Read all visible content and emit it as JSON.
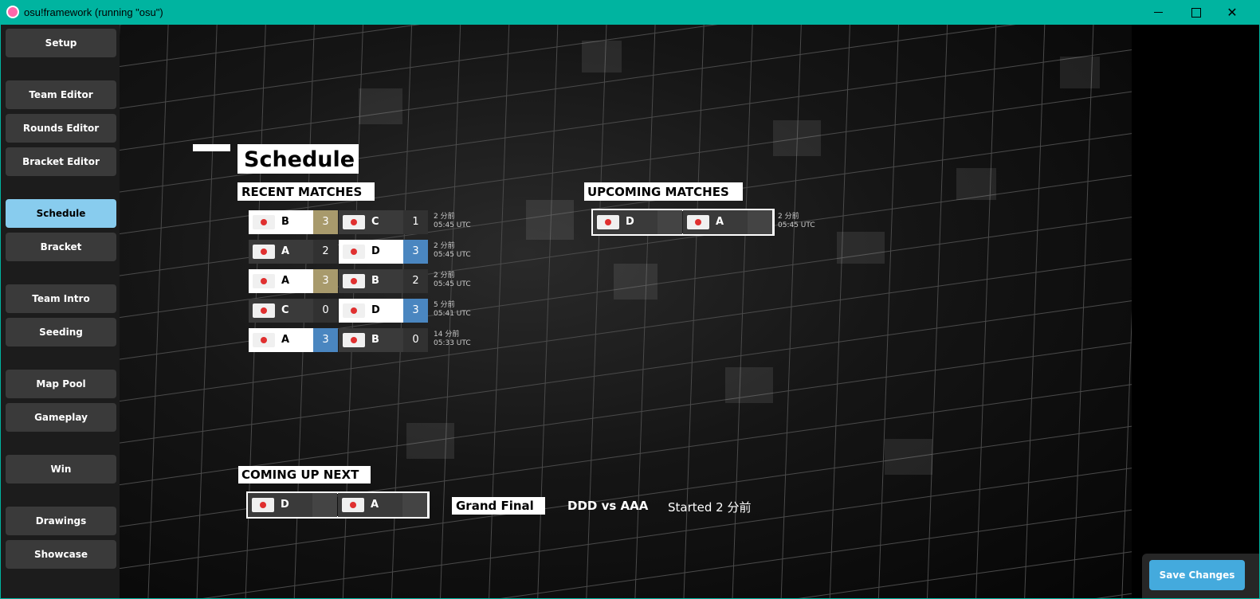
{
  "window": {
    "title": "osu!framework (running \"osu\")"
  },
  "sidebar": {
    "items": [
      {
        "label": "Setup",
        "active": false
      },
      {
        "label": "Team Editor",
        "active": false
      },
      {
        "label": "Rounds Editor",
        "active": false
      },
      {
        "label": "Bracket Editor",
        "active": false
      },
      {
        "label": "Schedule",
        "active": true
      },
      {
        "label": "Bracket",
        "active": false
      },
      {
        "label": "Team Intro",
        "active": false
      },
      {
        "label": "Seeding",
        "active": false
      },
      {
        "label": "Map Pool",
        "active": false
      },
      {
        "label": "Gameplay",
        "active": false
      },
      {
        "label": "Win",
        "active": false
      },
      {
        "label": "Drawings",
        "active": false
      },
      {
        "label": "Showcase",
        "active": false
      }
    ]
  },
  "schedule": {
    "title": "Schedule",
    "recent_label": "RECENT MATCHES",
    "upcoming_label": "UPCOMING MATCHES",
    "next_label": "COMING UP NEXT",
    "recent": [
      {
        "team1": "B",
        "score1": "3",
        "team2": "C",
        "score2": "1",
        "ago": "2 分前",
        "time": "05:45 UTC"
      },
      {
        "team1": "A",
        "score1": "2",
        "team2": "D",
        "score2": "3",
        "ago": "2 分前",
        "time": "05:45 UTC"
      },
      {
        "team1": "A",
        "score1": "3",
        "team2": "B",
        "score2": "2",
        "ago": "2 分前",
        "time": "05:45 UTC"
      },
      {
        "team1": "C",
        "score1": "0",
        "team2": "D",
        "score2": "3",
        "ago": "5 分前",
        "time": "05:41 UTC"
      },
      {
        "team1": "A",
        "score1": "3",
        "team2": "B",
        "score2": "0",
        "ago": "14 分前",
        "time": "05:33 UTC"
      }
    ],
    "upcoming": [
      {
        "team1": "D",
        "team2": "A",
        "ago": "2 分前",
        "time": "05:45 UTC"
      }
    ],
    "next": {
      "team1": "D",
      "team2": "A",
      "round": "Grand Final",
      "vs": "DDD vs AAA",
      "started": "Started 2 分前"
    }
  },
  "footer": {
    "save_label": "Save Changes"
  },
  "colors": {
    "titlebar": "#00b4a0",
    "active_tab": "#88ccee",
    "save_button": "#44aadd",
    "score_gold": "#a89a6c",
    "score_blue": "#4a86c0"
  }
}
